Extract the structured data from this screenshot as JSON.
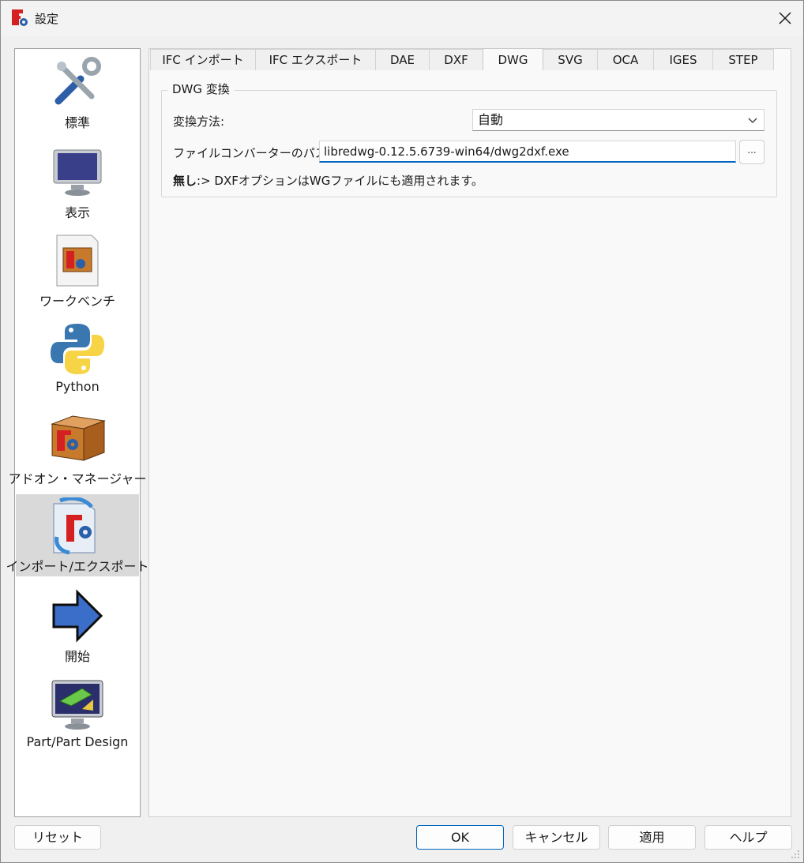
{
  "window": {
    "title": "設定"
  },
  "sidebar": {
    "items": [
      {
        "label": "標準",
        "icon": "tools-icon"
      },
      {
        "label": "表示",
        "icon": "monitor-icon"
      },
      {
        "label": "ワークベンチ",
        "icon": "workbench-icon"
      },
      {
        "label": "Python",
        "icon": "python-icon"
      },
      {
        "label": "アドオン・マネージャー",
        "icon": "addon-box-icon"
      },
      {
        "label": "インポート/エクスポート",
        "icon": "import-export-icon",
        "selected": true
      },
      {
        "label": "開始",
        "icon": "arrow-right-icon"
      },
      {
        "label": "Part/Part Design",
        "icon": "part-design-icon"
      }
    ]
  },
  "tabs": [
    {
      "label": "IFC インポート"
    },
    {
      "label": "IFC エクスポート"
    },
    {
      "label": "DAE"
    },
    {
      "label": "DXF"
    },
    {
      "label": "DWG",
      "active": true
    },
    {
      "label": "SVG"
    },
    {
      "label": "OCA"
    },
    {
      "label": "IGES"
    },
    {
      "label": "STEP"
    }
  ],
  "dwg": {
    "group_title": "DWG 変換",
    "method_label": "変換方法:",
    "method_value": "自動",
    "path_label": "ファイルコンバーターのパス",
    "path_value": "libredwg-0.12.5.6739-win64/dwg2dxf.exe",
    "browse_label": "...",
    "note_bold": "無し",
    "note_text": ":> DXFオプションはWGファイルにも適用されます。"
  },
  "buttons": {
    "reset": "リセット",
    "ok": "OK",
    "cancel": "キャンセル",
    "apply": "適用",
    "help": "ヘルプ"
  },
  "colors": {
    "accent": "#0067c0",
    "selected_bg": "#d9d9d9"
  }
}
